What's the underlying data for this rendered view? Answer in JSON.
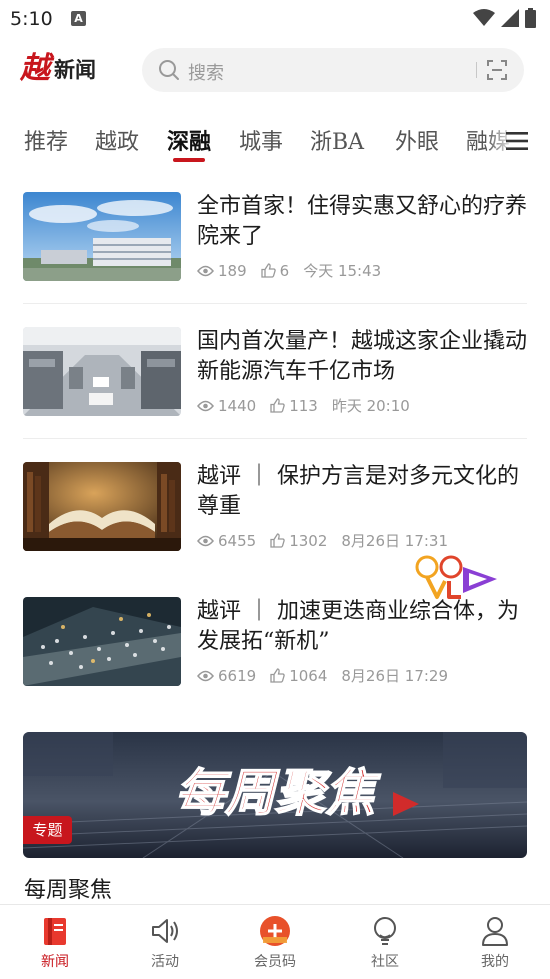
{
  "status_bar": {
    "time": "5:10",
    "indicator": "A"
  },
  "header": {
    "logo_mark": "越",
    "logo_text": "新闻",
    "search_placeholder": "搜索"
  },
  "tabs": [
    {
      "label": "推荐",
      "active": false
    },
    {
      "label": "越政",
      "active": false
    },
    {
      "label": "深融",
      "active": true
    },
    {
      "label": "城事",
      "active": false
    },
    {
      "label": "浙BA",
      "active": false
    },
    {
      "label": "外眼",
      "active": false
    },
    {
      "label": "融媒",
      "active": false
    }
  ],
  "articles": [
    {
      "title": "全市首家！住得实惠又舒心的疗养院来了",
      "views": "189",
      "likes": "6",
      "time": "今天 15:43"
    },
    {
      "title": "国内首次量产！越城这家企业撬动新能源汽车千亿市场",
      "views": "1440",
      "likes": "113",
      "time": "昨天 20:10"
    },
    {
      "title": "越评 ｜ 保护方言是对多元文化的尊重",
      "views": "6455",
      "likes": "1302",
      "time": "8月26日 17:31"
    },
    {
      "title": "越评 ｜ 加速更迭商业综合体，为发展拓“新机”",
      "views": "6619",
      "likes": "1064",
      "time": "8月26日 17:29"
    }
  ],
  "banner": {
    "image_text": "每周聚焦",
    "tag": "专题",
    "title": "每周聚焦"
  },
  "bottom_nav": [
    {
      "label": "新闻",
      "icon": "news-icon",
      "active": true
    },
    {
      "label": "活动",
      "icon": "speaker-icon",
      "active": false
    },
    {
      "label": "会员码",
      "icon": "member-code-icon",
      "active": false
    },
    {
      "label": "社区",
      "icon": "lightbulb-icon",
      "active": false
    },
    {
      "label": "我的",
      "icon": "user-icon",
      "active": false
    }
  ],
  "colors": {
    "brand": "#c8161d",
    "text": "#1c1c1c",
    "meta": "#999999"
  }
}
